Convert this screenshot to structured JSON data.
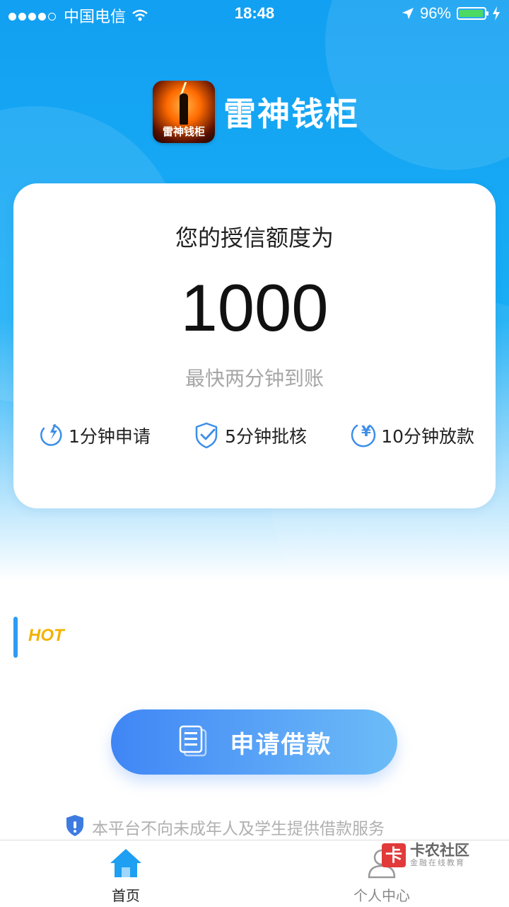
{
  "status_bar": {
    "carrier": "中国电信",
    "time": "18:48",
    "battery": "96%"
  },
  "brand": {
    "logo_text": "雷神钱柜",
    "name": "雷神钱柜"
  },
  "card": {
    "quota_label": "您的授信额度为",
    "quota_value": "1000",
    "subtitle": "最快两分钟到账",
    "features": [
      {
        "icon": "lightning-clock-icon",
        "label": "1分钟申请"
      },
      {
        "icon": "shield-check-icon",
        "label": "5分钟批核"
      },
      {
        "icon": "yen-clock-icon",
        "label": "10分钟放款"
      }
    ]
  },
  "hot": {
    "label": "HOT"
  },
  "apply_button": {
    "icon": "document-icon",
    "label": "申请借款"
  },
  "notice": {
    "icon": "shield-icon",
    "text": "本平台不向未成年人及学生提供借款服务"
  },
  "tabbar": {
    "home": {
      "icon": "home-icon",
      "label": "首页",
      "active": true
    },
    "profile": {
      "icon": "user-icon",
      "label": "个人中心",
      "active": false
    }
  },
  "watermark": {
    "logo": "卡",
    "title": "卡农社区",
    "subtitle": "金融在线教育"
  },
  "colors": {
    "primary": "#1aa8f4",
    "button": "#4a90f6",
    "hot": "#f2b200",
    "battery_fill": "#4cd964"
  }
}
